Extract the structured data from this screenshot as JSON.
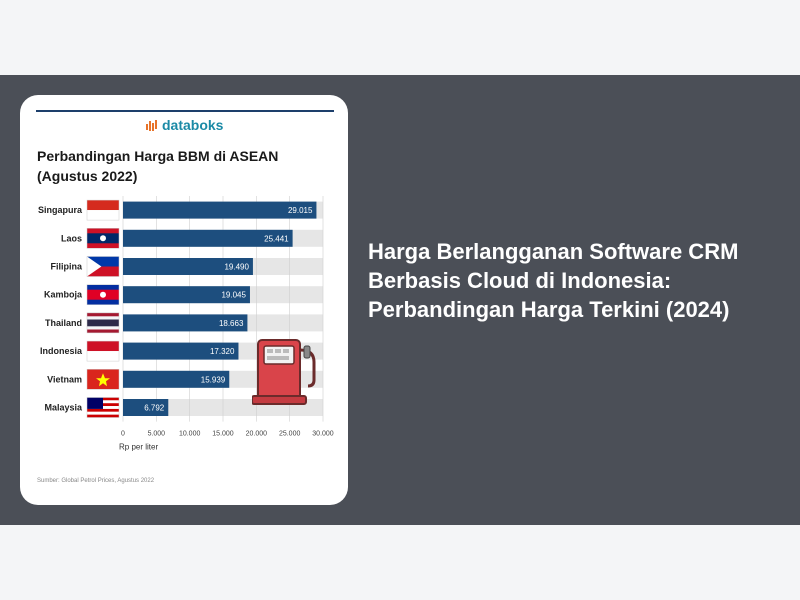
{
  "article": {
    "headline": "Harga Berlangganan Software CRM Berbasis Cloud di Indonesia: Perbandingan Harga Terkini (2024)"
  },
  "card": {
    "logo_text": "databoks",
    "source_text": "Sumber: Global Petrol Prices, Agustus 2022"
  },
  "chart_data": {
    "type": "bar",
    "orientation": "horizontal",
    "title": "Perbandingan Harga BBM di ASEAN",
    "subtitle": "(Agustus 2022)",
    "xlabel": "Rp per liter",
    "categories": [
      "Singapura",
      "Laos",
      "Filipina",
      "Kamboja",
      "Thailand",
      "Indonesia",
      "Vietnam",
      "Malaysia"
    ],
    "values": [
      29015,
      25441,
      19490,
      19045,
      18663,
      17320,
      15939,
      6792
    ],
    "value_labels": [
      "29.015",
      "25.441",
      "19.490",
      "19.045",
      "18.663",
      "17.320",
      "15.939",
      "6.792"
    ],
    "xlim": [
      0,
      30000
    ],
    "xticks": [
      0,
      5000,
      10000,
      15000,
      20000,
      25000,
      30000
    ],
    "xtick_labels": [
      "0",
      "5.000",
      "10.000",
      "15.000",
      "20.000",
      "25.000",
      "30.000"
    ],
    "grid": true,
    "bar_color": "#1d4e7e",
    "bg_stripe_color": "#e6e6e6"
  }
}
